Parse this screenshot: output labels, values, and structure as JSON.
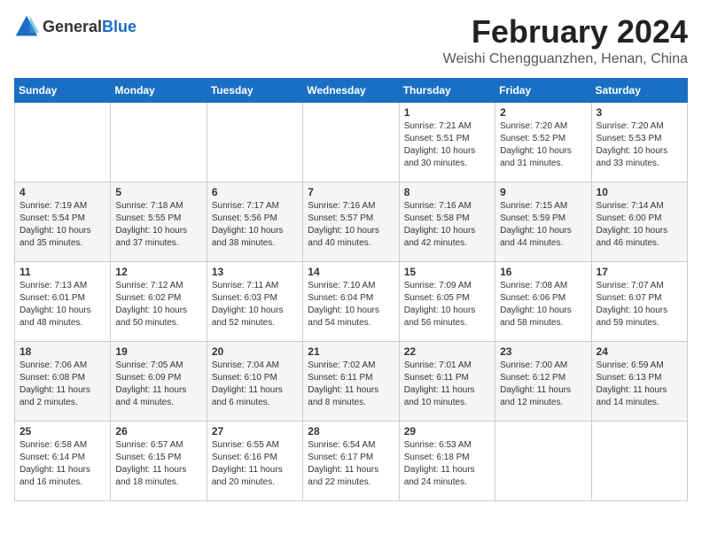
{
  "logo": {
    "text_general": "General",
    "text_blue": "Blue"
  },
  "title": "February 2024",
  "subtitle": "Weishi Chengguanzhen, Henan, China",
  "days_header": [
    "Sunday",
    "Monday",
    "Tuesday",
    "Wednesday",
    "Thursday",
    "Friday",
    "Saturday"
  ],
  "weeks": [
    [
      {
        "day": "",
        "content": ""
      },
      {
        "day": "",
        "content": ""
      },
      {
        "day": "",
        "content": ""
      },
      {
        "day": "",
        "content": ""
      },
      {
        "day": "1",
        "content": "Sunrise: 7:21 AM\nSunset: 5:51 PM\nDaylight: 10 hours\nand 30 minutes."
      },
      {
        "day": "2",
        "content": "Sunrise: 7:20 AM\nSunset: 5:52 PM\nDaylight: 10 hours\nand 31 minutes."
      },
      {
        "day": "3",
        "content": "Sunrise: 7:20 AM\nSunset: 5:53 PM\nDaylight: 10 hours\nand 33 minutes."
      }
    ],
    [
      {
        "day": "4",
        "content": "Sunrise: 7:19 AM\nSunset: 5:54 PM\nDaylight: 10 hours\nand 35 minutes."
      },
      {
        "day": "5",
        "content": "Sunrise: 7:18 AM\nSunset: 5:55 PM\nDaylight: 10 hours\nand 37 minutes."
      },
      {
        "day": "6",
        "content": "Sunrise: 7:17 AM\nSunset: 5:56 PM\nDaylight: 10 hours\nand 38 minutes."
      },
      {
        "day": "7",
        "content": "Sunrise: 7:16 AM\nSunset: 5:57 PM\nDaylight: 10 hours\nand 40 minutes."
      },
      {
        "day": "8",
        "content": "Sunrise: 7:16 AM\nSunset: 5:58 PM\nDaylight: 10 hours\nand 42 minutes."
      },
      {
        "day": "9",
        "content": "Sunrise: 7:15 AM\nSunset: 5:59 PM\nDaylight: 10 hours\nand 44 minutes."
      },
      {
        "day": "10",
        "content": "Sunrise: 7:14 AM\nSunset: 6:00 PM\nDaylight: 10 hours\nand 46 minutes."
      }
    ],
    [
      {
        "day": "11",
        "content": "Sunrise: 7:13 AM\nSunset: 6:01 PM\nDaylight: 10 hours\nand 48 minutes."
      },
      {
        "day": "12",
        "content": "Sunrise: 7:12 AM\nSunset: 6:02 PM\nDaylight: 10 hours\nand 50 minutes."
      },
      {
        "day": "13",
        "content": "Sunrise: 7:11 AM\nSunset: 6:03 PM\nDaylight: 10 hours\nand 52 minutes."
      },
      {
        "day": "14",
        "content": "Sunrise: 7:10 AM\nSunset: 6:04 PM\nDaylight: 10 hours\nand 54 minutes."
      },
      {
        "day": "15",
        "content": "Sunrise: 7:09 AM\nSunset: 6:05 PM\nDaylight: 10 hours\nand 56 minutes."
      },
      {
        "day": "16",
        "content": "Sunrise: 7:08 AM\nSunset: 6:06 PM\nDaylight: 10 hours\nand 58 minutes."
      },
      {
        "day": "17",
        "content": "Sunrise: 7:07 AM\nSunset: 6:07 PM\nDaylight: 10 hours\nand 59 minutes."
      }
    ],
    [
      {
        "day": "18",
        "content": "Sunrise: 7:06 AM\nSunset: 6:08 PM\nDaylight: 11 hours\nand 2 minutes."
      },
      {
        "day": "19",
        "content": "Sunrise: 7:05 AM\nSunset: 6:09 PM\nDaylight: 11 hours\nand 4 minutes."
      },
      {
        "day": "20",
        "content": "Sunrise: 7:04 AM\nSunset: 6:10 PM\nDaylight: 11 hours\nand 6 minutes."
      },
      {
        "day": "21",
        "content": "Sunrise: 7:02 AM\nSunset: 6:11 PM\nDaylight: 11 hours\nand 8 minutes."
      },
      {
        "day": "22",
        "content": "Sunrise: 7:01 AM\nSunset: 6:11 PM\nDaylight: 11 hours\nand 10 minutes."
      },
      {
        "day": "23",
        "content": "Sunrise: 7:00 AM\nSunset: 6:12 PM\nDaylight: 11 hours\nand 12 minutes."
      },
      {
        "day": "24",
        "content": "Sunrise: 6:59 AM\nSunset: 6:13 PM\nDaylight: 11 hours\nand 14 minutes."
      }
    ],
    [
      {
        "day": "25",
        "content": "Sunrise: 6:58 AM\nSunset: 6:14 PM\nDaylight: 11 hours\nand 16 minutes."
      },
      {
        "day": "26",
        "content": "Sunrise: 6:57 AM\nSunset: 6:15 PM\nDaylight: 11 hours\nand 18 minutes."
      },
      {
        "day": "27",
        "content": "Sunrise: 6:55 AM\nSunset: 6:16 PM\nDaylight: 11 hours\nand 20 minutes."
      },
      {
        "day": "28",
        "content": "Sunrise: 6:54 AM\nSunset: 6:17 PM\nDaylight: 11 hours\nand 22 minutes."
      },
      {
        "day": "29",
        "content": "Sunrise: 6:53 AM\nSunset: 6:18 PM\nDaylight: 11 hours\nand 24 minutes."
      },
      {
        "day": "",
        "content": ""
      },
      {
        "day": "",
        "content": ""
      }
    ]
  ]
}
